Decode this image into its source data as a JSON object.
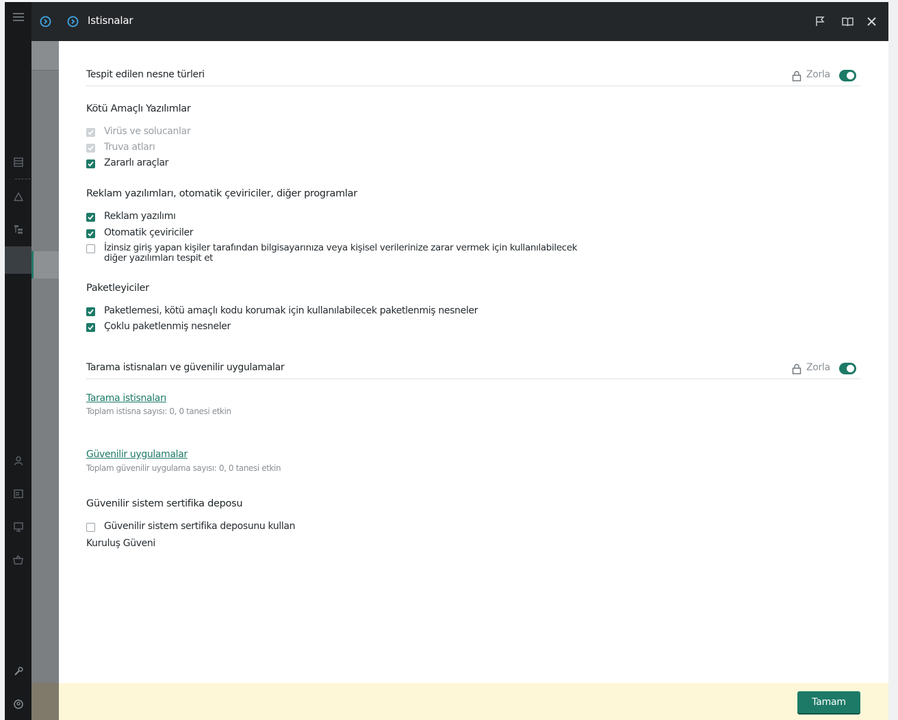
{
  "window": {
    "title": "Istisnalar",
    "icons": [
      "menu-icon",
      "back-icon",
      "circle-arrow-icon",
      "flag-icon",
      "book-icon",
      "close-icon"
    ]
  },
  "nav_rail": {
    "icons": [
      "list-icon",
      "warning-icon",
      "tree-icon",
      "user-icon",
      "card-icon",
      "monitor-icon",
      "basket-icon",
      "wrench-icon",
      "account-icon"
    ]
  },
  "sections": {
    "detected": {
      "title": "Tespit edilen nesne türleri",
      "enforce_label": "Zorla",
      "enforce_on": true
    },
    "scan": {
      "title": "Tarama istisnaları ve güvenilir uygulamalar",
      "enforce_label": "Zorla",
      "enforce_on": true
    }
  },
  "groups": {
    "malware": {
      "title": "Kötü Amaçlı Yazılımlar",
      "items": [
        {
          "label": "Virüs ve solucanlar",
          "state": "checked-disabled"
        },
        {
          "label": "Truva atları",
          "state": "checked-disabled"
        },
        {
          "label": "Zararlı araçlar",
          "state": "checked"
        }
      ]
    },
    "adware": {
      "title": "Reklam yazılımları, otomatik çeviriciler, diğer programlar",
      "items": [
        {
          "label": "Reklam yazılımı",
          "state": "checked"
        },
        {
          "label": "Otomatik çeviriciler",
          "state": "checked"
        },
        {
          "label": "İzinsiz giriş yapan kişiler tarafından bilgisayarınıza veya kişisel verilerinize zarar vermek için kullanılabilecek",
          "label_line2": "diğer yazılımları tespit et",
          "state": "unchecked"
        }
      ]
    },
    "packers": {
      "title": "Paketleyiciler",
      "items": [
        {
          "label": "Paketlemesi, kötü amaçlı kodu korumak için kullanılabilecek paketlenmiş nesneler",
          "state": "checked"
        },
        {
          "label": "Çoklu paketlenmiş nesneler",
          "state": "checked"
        }
      ]
    },
    "certs": {
      "title": "Güvenilir sistem sertifika deposu",
      "items": [
        {
          "label": "Güvenilir sistem sertifika deposunu kullan",
          "state": "unchecked"
        }
      ],
      "note": "Kuruluş Güveni"
    }
  },
  "links": {
    "scan_exclusions": {
      "label": "Tarama istisnaları",
      "subtitle": "Toplam istisna sayısı: 0, 0 tanesi etkin"
    },
    "trusted_apps": {
      "label": "Güvenilir uygulamalar",
      "subtitle": "Toplam güvenilir uygulama sayısı: 0, 0 tanesi etkin"
    }
  },
  "footer": {
    "ok_label": "Tamam"
  },
  "colors": {
    "accent": "#1d7a67",
    "header": "#24272a",
    "footer_bg": "#fdf7d8"
  }
}
